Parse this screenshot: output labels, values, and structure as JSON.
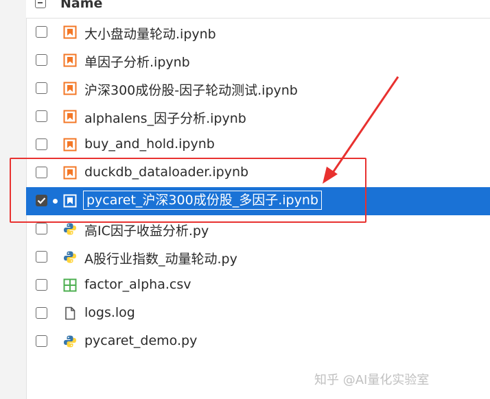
{
  "header": {
    "name_label": "Name"
  },
  "files": [
    {
      "name": "大小盘动量轮动.ipynb",
      "type": "notebook",
      "icon": "notebook-icon",
      "selected": false
    },
    {
      "name": "单因子分析.ipynb",
      "type": "notebook",
      "icon": "notebook-icon",
      "selected": false
    },
    {
      "name": "沪深300成份股-因子轮动测试.ipynb",
      "type": "notebook",
      "icon": "notebook-icon",
      "selected": false
    },
    {
      "name": "alphalens_因子分析.ipynb",
      "type": "notebook",
      "icon": "notebook-icon",
      "selected": false
    },
    {
      "name": "buy_and_hold.ipynb",
      "type": "notebook",
      "icon": "notebook-icon",
      "selected": false
    },
    {
      "name": "duckdb_dataloader.ipynb",
      "type": "notebook",
      "icon": "notebook-icon",
      "selected": false
    },
    {
      "name": "pycaret_沪深300成份股_多因子.ipynb",
      "type": "notebook",
      "icon": "notebook-icon",
      "selected": true
    },
    {
      "name": "高IC因子收益分析.py",
      "type": "python",
      "icon": "python-icon",
      "selected": false
    },
    {
      "name": "A股行业指数_动量轮动.py",
      "type": "python",
      "icon": "python-icon",
      "selected": false
    },
    {
      "name": "factor_alpha.csv",
      "type": "csv",
      "icon": "spreadsheet-icon",
      "selected": false
    },
    {
      "name": "logs.log",
      "type": "file",
      "icon": "file-icon",
      "selected": false
    },
    {
      "name": "pycaret_demo.py",
      "type": "python",
      "icon": "python-icon",
      "selected": false
    }
  ],
  "watermark": "知乎 @AI量化实验室",
  "colors": {
    "notebook_orange": "#f37726",
    "selection_blue": "#1a72d6",
    "annotation_red": "#e8312f",
    "python_blue": "#3776ab",
    "python_yellow": "#ffd43b",
    "csv_green": "#4caf50"
  }
}
